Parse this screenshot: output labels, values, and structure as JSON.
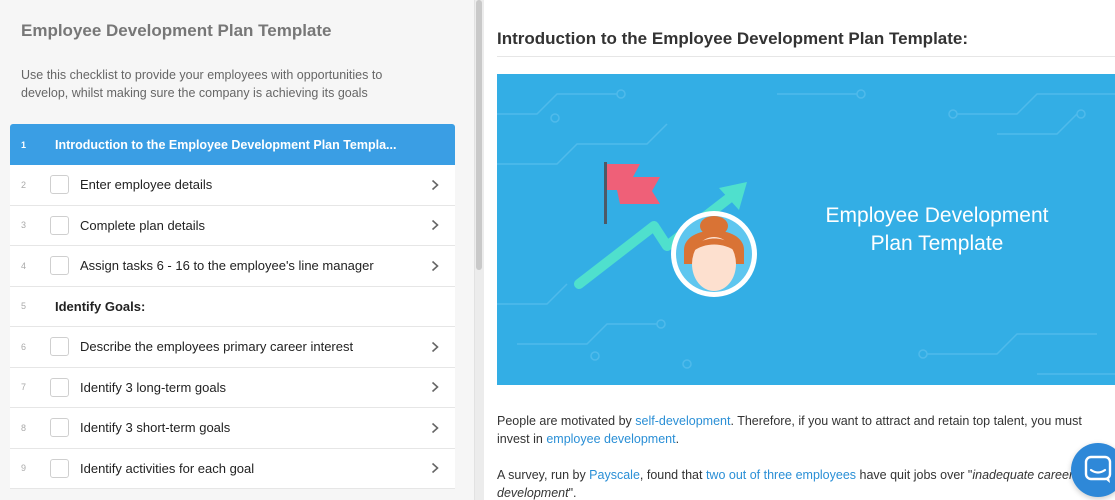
{
  "sidebar": {
    "title": "Employee Development Plan Template",
    "description": "Use this checklist to provide your employees with opportunities to develop, whilst making sure the company is achieving its goals",
    "items": [
      {
        "num": "1",
        "label": "Introduction to the Employee Development Plan Templa..."
      },
      {
        "num": "2",
        "label": "Enter employee details"
      },
      {
        "num": "3",
        "label": "Complete plan details"
      },
      {
        "num": "4",
        "label": "Assign tasks 6 - 16 to the employee's line manager"
      },
      {
        "num": "5",
        "label": "Identify Goals:"
      },
      {
        "num": "6",
        "label": "Describe the employees primary career interest"
      },
      {
        "num": "7",
        "label": "Identify 3 long-term goals"
      },
      {
        "num": "8",
        "label": "Identify 3 short-term goals"
      },
      {
        "num": "9",
        "label": "Identify activities for each goal"
      }
    ]
  },
  "main": {
    "title": "Introduction to the Employee Development Plan Template:",
    "banner_line1": "Employee Development",
    "banner_line2": "Plan Template",
    "p1": {
      "t1": "People are motivated by ",
      "link1": "self-development",
      "t2": ". Therefore, if you want to attract and retain top talent, you must invest in ",
      "link2": "employee development",
      "t3": "."
    },
    "p2": {
      "t1": "A survey, run by ",
      "link1": "Payscale",
      "t2": ", found that ",
      "link2": "two out of three employees",
      "t3": " have quit jobs over \"",
      "em": "inadequate career development",
      "t4": "\"."
    }
  },
  "colors": {
    "accent": "#3a9ee4",
    "banner": "#33aee5",
    "link": "#2a8fd6"
  }
}
